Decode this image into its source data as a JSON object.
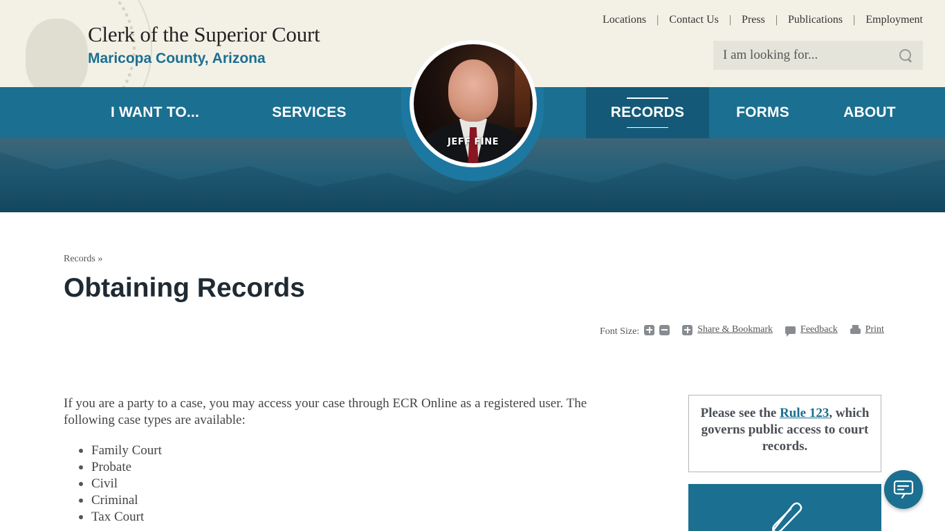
{
  "header": {
    "title": "Clerk of the Superior Court",
    "subtitle": "Maricopa County, Arizona",
    "seal_icon": "court-seal-icon",
    "utility_links": [
      "Locations",
      "Contact Us",
      "Press",
      "Publications",
      "Employment"
    ],
    "utility_separator": "|",
    "search": {
      "placeholder": "I am looking for...",
      "value": "",
      "icon": "search-icon"
    }
  },
  "nav": {
    "items": [
      {
        "label": "I WANT TO...",
        "active": false
      },
      {
        "label": "SERVICES",
        "active": false
      },
      {
        "label": "RECORDS",
        "active": true
      },
      {
        "label": "FORMS",
        "active": false
      },
      {
        "label": "ABOUT",
        "active": false
      }
    ]
  },
  "portrait": {
    "name": "JEFF FINE"
  },
  "breadcrumb": {
    "items": [
      "Records"
    ],
    "separator": "»"
  },
  "page": {
    "title": "Obtaining Records",
    "tools": {
      "font_size_label": "Font Size:",
      "share_label": "Share & Bookmark",
      "feedback_label": "Feedback",
      "print_label": "Print"
    },
    "intro": "If you are a party to a case, you may access your case through ECR Online as a registered user. The following case types are available:",
    "case_types": [
      "Family Court",
      "Probate",
      "Civil",
      "Criminal",
      "Tax Court"
    ]
  },
  "sidebar": {
    "notice_prefix": "Please see the ",
    "notice_link": "Rule 123",
    "notice_suffix": ", which governs public access to court records.",
    "card_icon": "paperclip-icon"
  },
  "chat": {
    "icon": "chat-bubble-icon"
  },
  "colors": {
    "brand_blue": "#1b6f91",
    "active_nav": "#145a78",
    "header_bg": "#f3f1e6",
    "title_dark": "#1f2a33"
  }
}
